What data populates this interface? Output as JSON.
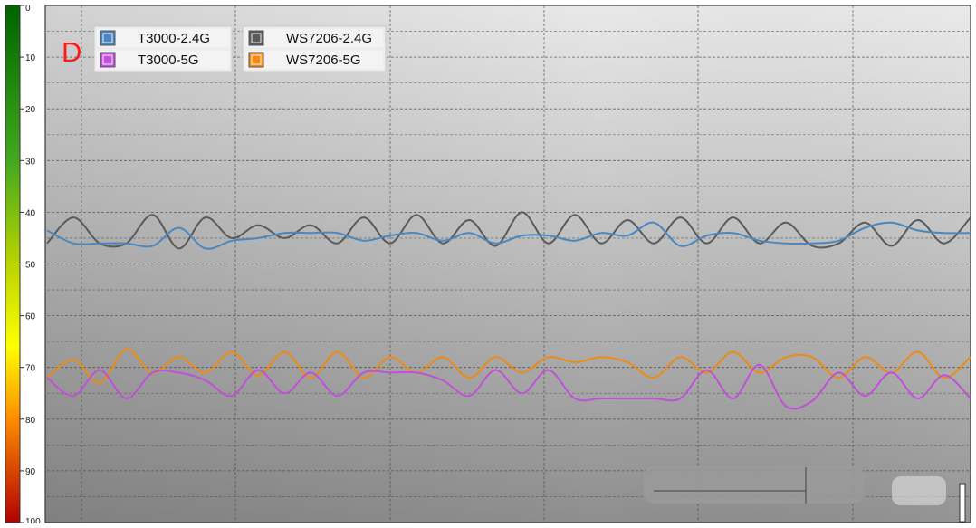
{
  "panel_label": "D",
  "chart_data": {
    "type": "line",
    "title": "",
    "xlabel": "",
    "ylabel": "",
    "ylim": [
      0,
      100
    ],
    "y_inverted": true,
    "y_ticks": [
      "0",
      "10",
      "20",
      "30",
      "40",
      "50",
      "60",
      "70",
      "80",
      "90",
      "100"
    ],
    "grid": true,
    "legend_position": "top-left",
    "color_scale": {
      "top": "#006400",
      "bottom": "#b00000"
    },
    "series": [
      {
        "name": "T3000-2.4G",
        "color": "#4a87c0",
        "values": [
          43.5,
          46,
          46,
          46,
          46.5,
          43,
          47,
          45.5,
          45,
          44,
          44,
          44,
          45.5,
          44.5,
          44,
          45.5,
          44,
          46,
          44.5,
          44.5,
          45.5,
          44,
          44.5,
          42,
          46.5,
          44.5,
          44,
          45.5,
          46,
          46,
          45.5,
          43,
          42,
          43.5,
          44,
          44
        ]
      },
      {
        "name": "WS7206-2.4G",
        "color": "#5a5a5a",
        "values": [
          46,
          41,
          46,
          46,
          40.5,
          47,
          41,
          45,
          42.5,
          45,
          42.5,
          46,
          41,
          46,
          40.5,
          46,
          41.5,
          46.5,
          40,
          46,
          40.5,
          46,
          41.5,
          46,
          41,
          46,
          41,
          46,
          42,
          46.5,
          46,
          42,
          46.5,
          41.5,
          46,
          41
        ]
      },
      {
        "name": "T3000-5G",
        "color": "#c050d8",
        "values": [
          72,
          75.5,
          70.5,
          76,
          71,
          71,
          72.5,
          75.5,
          70.5,
          75,
          71,
          75.5,
          71,
          71,
          71,
          72.5,
          75.5,
          70.5,
          75,
          70.5,
          76,
          76,
          76,
          76,
          76,
          70.5,
          76,
          69.5,
          77.5,
          76.5,
          71,
          75.5,
          71,
          76,
          71.5,
          76
        ]
      },
      {
        "name": "WS7206-5G",
        "color": "#f08a10",
        "values": [
          72,
          68.5,
          73,
          66.5,
          71,
          68,
          71,
          67,
          71.5,
          67,
          72,
          67,
          72,
          68,
          71,
          68,
          72,
          68,
          71,
          68,
          69,
          68,
          69,
          72,
          68,
          71,
          67,
          71,
          68,
          68,
          72,
          68,
          71,
          67,
          72,
          68
        ]
      }
    ]
  }
}
